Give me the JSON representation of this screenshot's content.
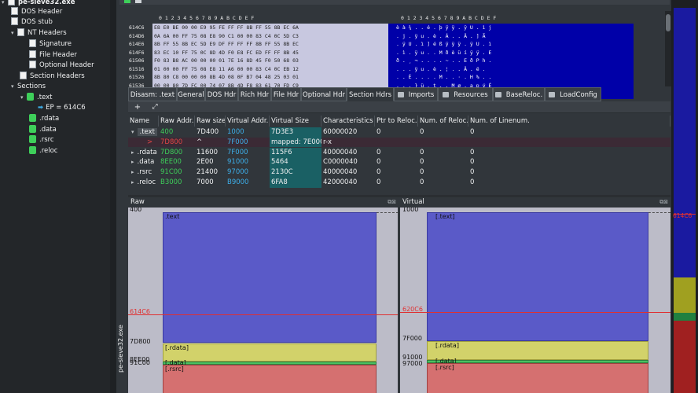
{
  "tree": {
    "items": [
      {
        "label": "pe-sieve32.exe",
        "arrow": "▾",
        "icon": "doc-icon"
      },
      {
        "label": "DOS Header",
        "arrow": "",
        "icon": "doc-icon"
      },
      {
        "label": "DOS stub",
        "arrow": "",
        "icon": "doc-icon"
      },
      {
        "label": "NT Headers",
        "arrow": "▾",
        "icon": "doc-icon"
      },
      {
        "label": "Signature",
        "arrow": "",
        "icon": "doc-icon"
      },
      {
        "label": "File Header",
        "arrow": "",
        "icon": "doc-icon"
      },
      {
        "label": "Optional Header",
        "arrow": "",
        "icon": "doc-icon"
      },
      {
        "label": "Section Headers",
        "arrow": "",
        "icon": "doc-icon"
      },
      {
        "label": "Sections",
        "arrow": "▾",
        "icon": ""
      },
      {
        "label": ".text",
        "arrow": "▾",
        "icon": "section-icon"
      },
      {
        "label": "EP = 614C6",
        "arrow": "",
        "icon": "entry-arrow-icon"
      },
      {
        "label": ".rdata",
        "arrow": "",
        "icon": "section-icon"
      },
      {
        "label": ".data",
        "arrow": "",
        "icon": "section-icon"
      },
      {
        "label": ".rsrc",
        "arrow": "",
        "icon": "section-icon"
      },
      {
        "label": ".reloc",
        "arrow": "",
        "icon": "section-icon"
      }
    ]
  },
  "hex": {
    "header_bytes": "0  1  2  3  4  5  6  7  8  9  A  B  C  D  E  F",
    "header_ascii": "0 1 2 3 4 5 6 7 8 9 A B C D E F",
    "rows": [
      {
        "addr": "614C6",
        "bytes": "E8 E0 BE 00 00 E9 95 FE FF FF 8B FF 55 8B EC 6A",
        "ascii": "è à ¾ . . é . þ ÿ ÿ . ÿ U . ì j"
      },
      {
        "addr": "614D6",
        "bytes": "0A 6A 00 FF 75 08 E8 90 C1 00 00 83 C4 0C 5D C3",
        "ascii": ". j . ÿ u . è . Á . . Ä . ] Ã"
      },
      {
        "addr": "614E6",
        "bytes": "8B FF 55 8B EC 5D E9 DF FF FF FF 8B FF 55 8B EC",
        "ascii": ". ÿ U . ì ] é ß ÿ ÿ ÿ . ÿ U . ì"
      },
      {
        "addr": "614F6",
        "bytes": "83 EC 10 FF 75 0C 8D 4D F0 E8 FC ED FF FF 8B 45",
        "ascii": ". ì . ÿ u . . M ð è ü í ÿ ÿ . E"
      },
      {
        "addr": "61506",
        "bytes": "F0 83 B8 AC 00 00 00 01 7E 16 8D 45 F0 50 68 03",
        "ascii": "ð . ¸ ¬ . . . . ~ . . E ð P h ."
      },
      {
        "addr": "61516",
        "bytes": "01 00 00 FF 75 08 E8 11 A6 00 00 83 C4 0C EB 12",
        "ascii": ". . . ÿ u . è . ¦ . . Ä . ë ."
      },
      {
        "addr": "61526",
        "bytes": "8B 80 C8 00 00 00 8B 4D 08 0F B7 04 48 25 03 01",
        "ascii": ". . È . . . . M . . · . H % . ."
      },
      {
        "addr": "61536",
        "bytes": "00 00 80 7D FC 00 74 07 8B 4D F8 83 61 70 FD C9",
        "ascii": ". . . } ü . t . . M ø . a p ý É"
      },
      {
        "addr": "61546",
        "bytes": "C3 8B FF 55 8B EC 83 3D A0 45 49 00 00 75 14 8B",
        "ascii": "Ã . ÿ U . ì . =   E I . . u . ."
      }
    ]
  },
  "tabs": [
    {
      "label": "Disasm: .text",
      "icon": ""
    },
    {
      "label": "General",
      "icon": ""
    },
    {
      "label": "DOS Hdr",
      "icon": ""
    },
    {
      "label": "Rich Hdr",
      "icon": ""
    },
    {
      "label": "File Hdr",
      "icon": ""
    },
    {
      "label": "Optional Hdr",
      "icon": ""
    },
    {
      "label": "Section Hdrs",
      "icon": "",
      "active": true
    },
    {
      "label": "Imports",
      "icon": "folder-icon"
    },
    {
      "label": "Resources",
      "icon": "folder-icon"
    },
    {
      "label": "BaseReloc.",
      "icon": "folder-icon"
    },
    {
      "label": "LoadConfig",
      "icon": "folder-icon"
    }
  ],
  "toolbar": {
    "add": "+",
    "fit": "⤢"
  },
  "table": {
    "headers": [
      "Name",
      "Raw Addr.",
      "Raw size",
      "Virtual Addr.",
      "Virtual Size",
      "Characteristics",
      "Ptr to Reloc.",
      "Num. of Reloc.",
      "Num. of Linenum."
    ],
    "rows": [
      {
        "arrow": "▾",
        "name": ".text",
        "raw_addr": "400",
        "raw_size": "7D400",
        "va": "1000",
        "vsize": "7D3E3",
        "chars": "60000020",
        "ptr_reloc": "0",
        "num_reloc": "0",
        "num_line": "0"
      },
      {
        "arrow": ">",
        "name": "",
        "raw_addr": "7D800",
        "raw_size": "^",
        "va": "7F000",
        "vsize": "mapped: 7E000",
        "chars": "r-x",
        "ptr_reloc": "",
        "num_reloc": "",
        "num_line": "",
        "sub": true
      },
      {
        "arrow": "▸",
        "name": ".rdata",
        "raw_addr": "7D800",
        "raw_size": "11600",
        "va": "7F000",
        "vsize": "115F6",
        "chars": "40000040",
        "ptr_reloc": "0",
        "num_reloc": "0",
        "num_line": "0"
      },
      {
        "arrow": "▸",
        "name": ".data",
        "raw_addr": "8EE00",
        "raw_size": "2E00",
        "va": "91000",
        "vsize": "5464",
        "chars": "C0000040",
        "ptr_reloc": "0",
        "num_reloc": "0",
        "num_line": "0"
      },
      {
        "arrow": "▸",
        "name": ".rsrc",
        "raw_addr": "91C00",
        "raw_size": "21400",
        "va": "97000",
        "vsize": "2130C",
        "chars": "40000040",
        "ptr_reloc": "0",
        "num_reloc": "0",
        "num_line": "0"
      },
      {
        "arrow": "▸",
        "name": ".reloc",
        "raw_addr": "B3000",
        "raw_size": "7000",
        "va": "B9000",
        "vsize": "6FA8",
        "chars": "42000040",
        "ptr_reloc": "0",
        "num_reloc": "0",
        "num_line": "0"
      }
    ]
  },
  "raw_view": {
    "title": "Raw",
    "filename": "pe-sieve32.exe",
    "labels": {
      "top": "400",
      "ep": "614C6",
      "rdata": "7D800",
      "data": "8EE00",
      "rsrc": "91C00"
    },
    "blocks": [
      ".text",
      "[.rdata]",
      "[.data]",
      "[.rsrc]"
    ],
    "colors": {
      "text": "#5a5ac8",
      "rdata": "#d2d26a",
      "data": "#4cc060",
      "rsrc": "#d57070"
    }
  },
  "virtual_view": {
    "title": "Virtual",
    "labels": {
      "top": "1000",
      "ep": "620C6",
      "rdata": "7F000",
      "data": "91000",
      "rsrc": "97000"
    },
    "blocks": [
      "[.text]",
      "[.rdata]",
      "[.data]",
      "[.rsrc]"
    ],
    "side_label": "614C6"
  },
  "panel_buttons": "⧉⊠"
}
